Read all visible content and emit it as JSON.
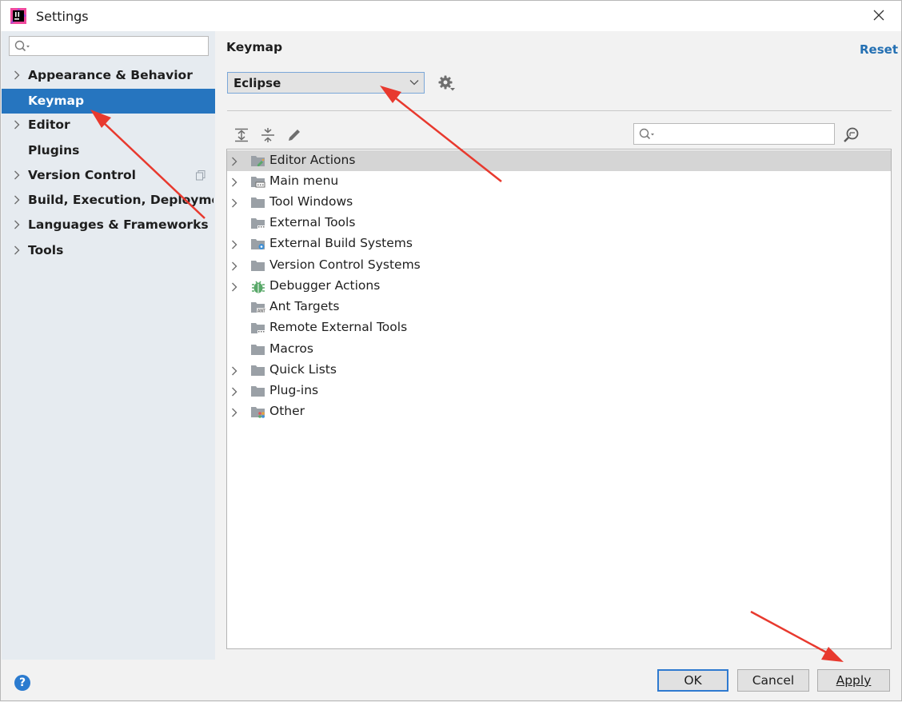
{
  "window": {
    "title": "Settings"
  },
  "sidebar": {
    "search_placeholder": "",
    "items": [
      {
        "label": "Appearance & Behavior",
        "expandable": true
      },
      {
        "label": "Keymap",
        "expandable": false,
        "selected": true
      },
      {
        "label": "Editor",
        "expandable": true
      },
      {
        "label": "Plugins",
        "expandable": false
      },
      {
        "label": "Version Control",
        "expandable": true
      },
      {
        "label": "Build, Execution, Deployment",
        "expandable": true
      },
      {
        "label": "Languages & Frameworks",
        "expandable": true
      },
      {
        "label": "Tools",
        "expandable": true
      }
    ]
  },
  "main": {
    "title": "Keymap",
    "reset_label": "Reset",
    "keymap_value": "Eclipse",
    "filter_placeholder": "",
    "tree": [
      {
        "label": "Editor Actions",
        "expandable": true,
        "selected": true,
        "icon": "editor-actions-folder-icon"
      },
      {
        "label": "Main menu",
        "expandable": true,
        "icon": "main-menu-folder-icon"
      },
      {
        "label": "Tool Windows",
        "expandable": true,
        "icon": "folder-icon"
      },
      {
        "label": "External Tools",
        "expandable": false,
        "icon": "external-tools-folder-icon"
      },
      {
        "label": "External Build Systems",
        "expandable": true,
        "icon": "build-systems-folder-icon"
      },
      {
        "label": "Version Control Systems",
        "expandable": true,
        "icon": "folder-icon"
      },
      {
        "label": "Debugger Actions",
        "expandable": true,
        "icon": "bug-icon"
      },
      {
        "label": "Ant Targets",
        "expandable": false,
        "icon": "ant-folder-icon"
      },
      {
        "label": "Remote External Tools",
        "expandable": false,
        "icon": "remote-tools-folder-icon"
      },
      {
        "label": "Macros",
        "expandable": false,
        "icon": "folder-icon"
      },
      {
        "label": "Quick Lists",
        "expandable": true,
        "icon": "folder-icon"
      },
      {
        "label": "Plug-ins",
        "expandable": true,
        "icon": "folder-icon"
      },
      {
        "label": "Other",
        "expandable": true,
        "icon": "other-folder-icon"
      }
    ]
  },
  "footer": {
    "help_label": "?",
    "ok_label": "OK",
    "cancel_label": "Cancel",
    "apply_label": "Apply"
  },
  "colors": {
    "accent": "#2675bf",
    "selection_row": "#d5d5d5",
    "annotation_arrow": "#e8392e"
  }
}
